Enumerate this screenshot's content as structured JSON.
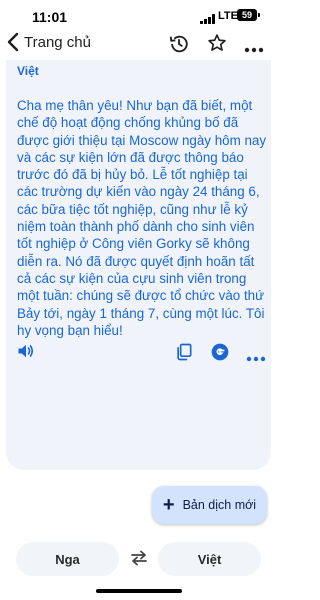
{
  "status": {
    "time": "11:01",
    "network": "LTE",
    "battery": "59"
  },
  "nav": {
    "back_label": "Trang chủ"
  },
  "card": {
    "language": "Việt",
    "text": "Cha mẹ thân yêu! Như bạn đã biết, một\nchế độ hoạt động chống khủng bố đã\nđược giới thiệu tại Moscow ngày hôm nay\nvà các sự kiện lớn đã được thông báo\ntrước đó đã bị hủy bỏ. Lễ tốt nghiệp tại\ncác trường dự kiến vào ngày 24 tháng 6,\ncác bữa tiệc tốt nghiệp, cũng như lễ kỷ\nniệm toàn thành phố dành cho sinh viên\ntốt nghiệp ở Công viên Gorky sẽ không\ndiễn ra. Nó đã được quyết định hoãn tất\ncả các sự kiện của cựu sinh viên trong\nmột tuần: chúng sẽ được tổ chức vào thứ\nBảy tới, ngày 1 tháng 7, cùng một lúc. Tôi\nhy vọng bạn hiểu!"
  },
  "fab": {
    "label": "Bản dịch mới"
  },
  "languages": {
    "source": "Nga",
    "target": "Việt"
  },
  "colors": {
    "accent": "#1a67d2",
    "card_bg": "#f0f4fa",
    "fab_bg": "#d3e3fd"
  },
  "icons": {
    "back": "chevron-left-icon",
    "history": "history-icon",
    "star": "star-outline-icon",
    "more": "more-horizontal-icon",
    "speaker": "speaker-icon",
    "copy": "copy-icon",
    "google": "google-g-icon",
    "swap": "swap-arrows-icon"
  }
}
